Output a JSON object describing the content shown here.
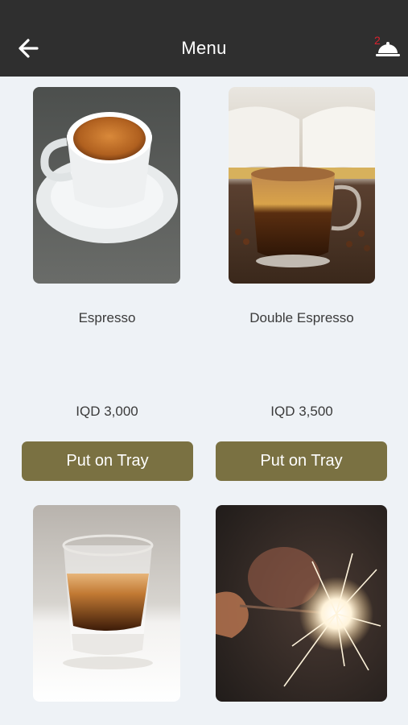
{
  "header": {
    "title": "Menu",
    "back_icon": "arrow-left-icon",
    "tray_icon": "cloche-icon",
    "tray_count": "2",
    "tray_count_color": "#d8222f",
    "background": "#2f2f2f"
  },
  "items": [
    {
      "name": "Espresso",
      "price": "IQD 3,000",
      "button_label": "Put on Tray"
    },
    {
      "name": "Double Espresso",
      "price": "IQD 3,500",
      "button_label": "Put on Tray"
    },
    {
      "name": "",
      "price": "",
      "button_label": ""
    },
    {
      "name": "",
      "price": "",
      "button_label": ""
    }
  ],
  "colors": {
    "accent": "#7a7142",
    "page_background": "#eef2f6"
  }
}
